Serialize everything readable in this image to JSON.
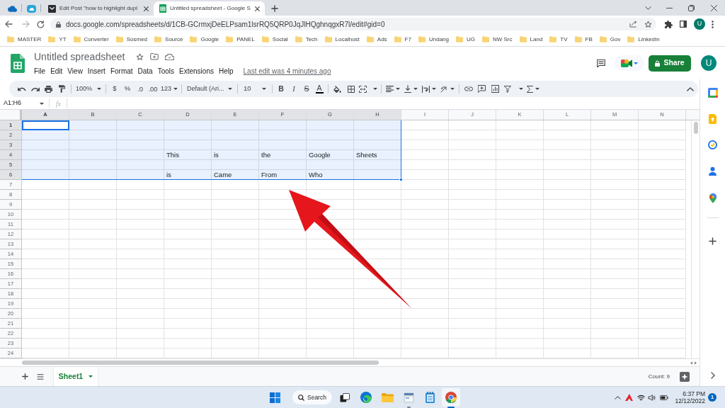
{
  "browser": {
    "tabs": [
      {
        "kind": "cloud",
        "selected": false
      },
      {
        "kind": "cloudtile",
        "selected": false
      },
      {
        "kind": "post",
        "title": "Edit Post \"how to highlight dupl",
        "selected": false
      },
      {
        "kind": "sheet",
        "title": "Untitled spreadsheet - Google S",
        "selected": true
      }
    ],
    "url": "docs.google.com/spreadsheets/d/1CB-GCrmxjDeELPsam1lsrRQ5QRP0JqJlHQghnqgxR7l/edit#gid=0",
    "profile": "U",
    "bookmarks": [
      "MASTER",
      "YT",
      "Converter",
      "Sosmed",
      "Source",
      "Google",
      "PANEL",
      "Social",
      "Tech",
      "Localhost",
      "Ads",
      "F7",
      "Undang",
      "UG",
      "NW Src",
      "Land",
      "TV",
      "FB",
      "Gov",
      "LinkedIn"
    ]
  },
  "sheets": {
    "title": "Untitled spreadsheet",
    "menus": [
      "File",
      "Edit",
      "View",
      "Insert",
      "Format",
      "Data",
      "Tools",
      "Extensions",
      "Help"
    ],
    "last_edit": "Last edit was 4 minutes ago",
    "share": "Share",
    "avatar": "U"
  },
  "toolbar": {
    "zoom": "100%",
    "currency": "$",
    "percent": "%",
    "decrease_decimal": ".0",
    "increase_decimal": ".00",
    "number_format": "123",
    "font": "Default (Ari...",
    "font_size": "10",
    "bold": "B",
    "italic": "I",
    "strikethrough": "S",
    "text_color": "A"
  },
  "formula_bar": {
    "name_box": "A1:H6",
    "fx": "fx"
  },
  "grid": {
    "columns": [
      {
        "label": "A",
        "selected": true,
        "active": true
      },
      {
        "label": "B",
        "selected": true,
        "active": false
      },
      {
        "label": "C",
        "selected": true,
        "active": false
      },
      {
        "label": "D",
        "selected": true,
        "active": false
      },
      {
        "label": "E",
        "selected": true,
        "active": false
      },
      {
        "label": "F",
        "selected": true,
        "active": false
      },
      {
        "label": "G",
        "selected": true,
        "active": false
      },
      {
        "label": "H",
        "selected": true,
        "active": false
      },
      {
        "label": "I",
        "selected": false,
        "active": false
      },
      {
        "label": "J",
        "selected": false,
        "active": false
      },
      {
        "label": "K",
        "selected": false,
        "active": false
      },
      {
        "label": "L",
        "selected": false,
        "active": false
      },
      {
        "label": "M",
        "selected": false,
        "active": false
      },
      {
        "label": "N",
        "selected": false,
        "active": false
      }
    ],
    "rows": [
      {
        "label": "1",
        "selected": true,
        "active": true
      },
      {
        "label": "2",
        "selected": true,
        "active": false
      },
      {
        "label": "3",
        "selected": true,
        "active": false
      },
      {
        "label": "4",
        "selected": true,
        "active": false,
        "cells": [
          null,
          null,
          null,
          "This",
          "is",
          "the",
          "Google",
          "Sheets"
        ]
      },
      {
        "label": "5",
        "selected": true,
        "active": false
      },
      {
        "label": "6",
        "selected": true,
        "active": false,
        "cells": [
          null,
          null,
          null,
          "is",
          "Came",
          "From",
          "Who"
        ]
      },
      {
        "label": "7",
        "selected": false,
        "active": false
      },
      {
        "label": "8",
        "selected": false,
        "active": false
      },
      {
        "label": "9",
        "selected": false,
        "active": false
      },
      {
        "label": "10",
        "selected": false,
        "active": false
      },
      {
        "label": "11",
        "selected": false,
        "active": false
      },
      {
        "label": "12",
        "selected": false,
        "active": false
      },
      {
        "label": "13",
        "selected": false,
        "active": false
      },
      {
        "label": "14",
        "selected": false,
        "active": false
      },
      {
        "label": "15",
        "selected": false,
        "active": false
      },
      {
        "label": "16",
        "selected": false,
        "active": false
      },
      {
        "label": "17",
        "selected": false,
        "active": false
      },
      {
        "label": "18",
        "selected": false,
        "active": false
      },
      {
        "label": "19",
        "selected": false,
        "active": false
      },
      {
        "label": "20",
        "selected": false,
        "active": false
      },
      {
        "label": "21",
        "selected": false,
        "active": false
      },
      {
        "label": "22",
        "selected": false,
        "active": false
      },
      {
        "label": "23",
        "selected": false,
        "active": false
      },
      {
        "label": "24",
        "selected": false,
        "active": false
      }
    ]
  },
  "sheet_tabs": [
    {
      "label": "Sheet1",
      "selected": true
    }
  ],
  "status": "Count: 9",
  "taskbar": {
    "search": "Search",
    "apps": [
      {
        "kind": "taskview",
        "running": false,
        "active": false
      },
      {
        "kind": "wave",
        "running": false,
        "active": false
      },
      {
        "kind": "folder",
        "running": false,
        "active": false
      },
      {
        "kind": "window",
        "running": true,
        "active": false
      },
      {
        "kind": "notepad",
        "running": false,
        "active": false
      },
      {
        "kind": "orb",
        "running": true,
        "active": true
      }
    ],
    "time": "6:37 PM",
    "date": "12/12/2022",
    "badge": "1"
  }
}
